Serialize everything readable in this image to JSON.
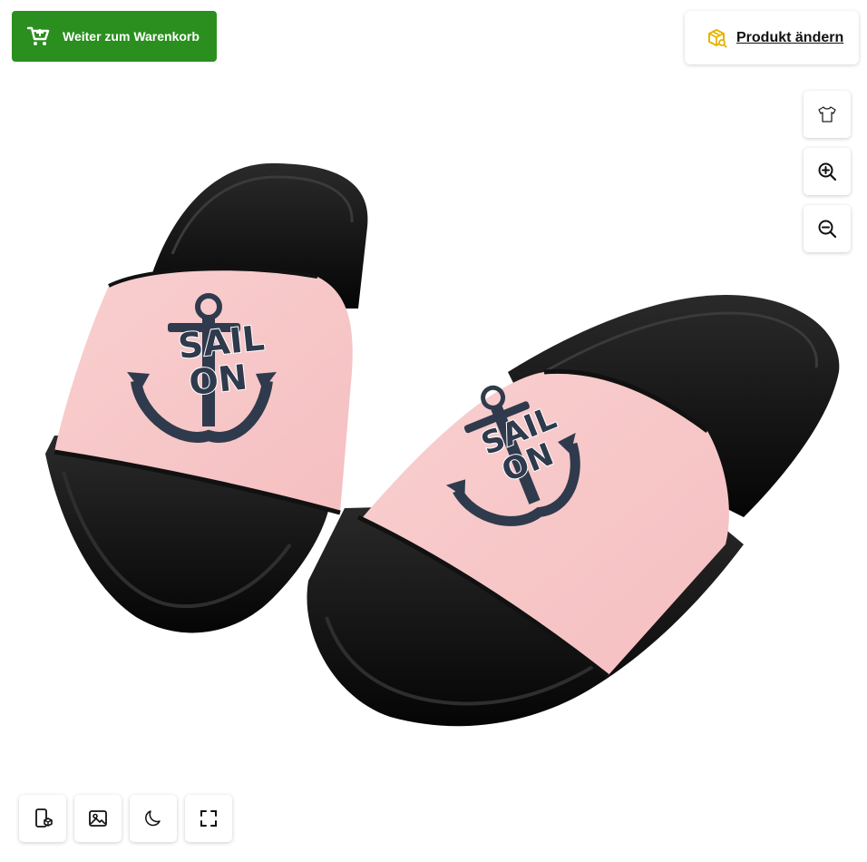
{
  "toolbar": {
    "cart_label": "Weiter zum Warenkorb",
    "change_product_label": "Produkt ändern"
  },
  "side_tools": [
    {
      "name": "product-view-button",
      "icon": "tshirt-icon"
    },
    {
      "name": "zoom-in-button",
      "icon": "zoom-in-icon"
    },
    {
      "name": "zoom-out-button",
      "icon": "zoom-out-icon"
    }
  ],
  "bottom_tools": [
    {
      "name": "ar-view-button",
      "icon": "phone-cube-icon"
    },
    {
      "name": "background-image-button",
      "icon": "image-icon"
    },
    {
      "name": "dark-mode-button",
      "icon": "moon-icon"
    },
    {
      "name": "fullscreen-button",
      "icon": "fullscreen-icon"
    }
  ],
  "product": {
    "strap_text_top": "SAIL",
    "strap_text_bottom": "ON"
  },
  "colors": {
    "cart_button": "#2a8f1f",
    "strap": "#f7c6c7",
    "sole": "#111111",
    "print": "#2f3a4d",
    "package_icon": "#e5b400"
  }
}
